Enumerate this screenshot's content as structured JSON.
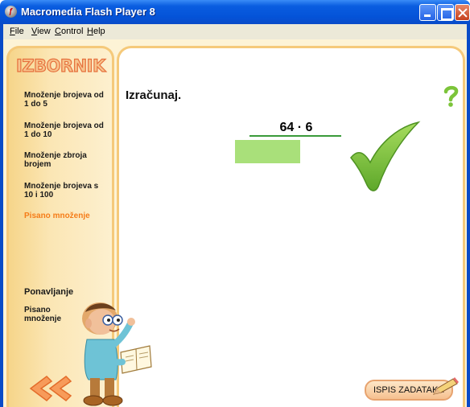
{
  "window": {
    "title": "Macromedia Flash Player 8"
  },
  "menubar": {
    "items": [
      "File",
      "View",
      "Control",
      "Help"
    ]
  },
  "sidebar": {
    "title": "IZBORNIK",
    "items": [
      {
        "label": "Množenje brojeva od 1 do 5",
        "active": false
      },
      {
        "label": "Množenje brojeva od 1 do 10",
        "active": false
      },
      {
        "label": "Množenje zbroja brojem",
        "active": false
      },
      {
        "label": "Množenje brojeva s 10 i 100",
        "active": false
      },
      {
        "label": "Pisano množenje",
        "active": true
      }
    ],
    "review_heading": "Ponavljanje",
    "review_item": "Pisano množenje"
  },
  "main": {
    "heading": "Izračunaj.",
    "problem": "64 · 6",
    "answer_value": "",
    "print_button_label": "ISPIS ZADATAKA"
  },
  "colors": {
    "accent_orange": "#f57c18",
    "check_green": "#7cc43a",
    "answer_box": "#a9e07a"
  },
  "icons": [
    "help-icon",
    "checkmark-icon",
    "back-arrows-icon",
    "pencil-icon"
  ]
}
